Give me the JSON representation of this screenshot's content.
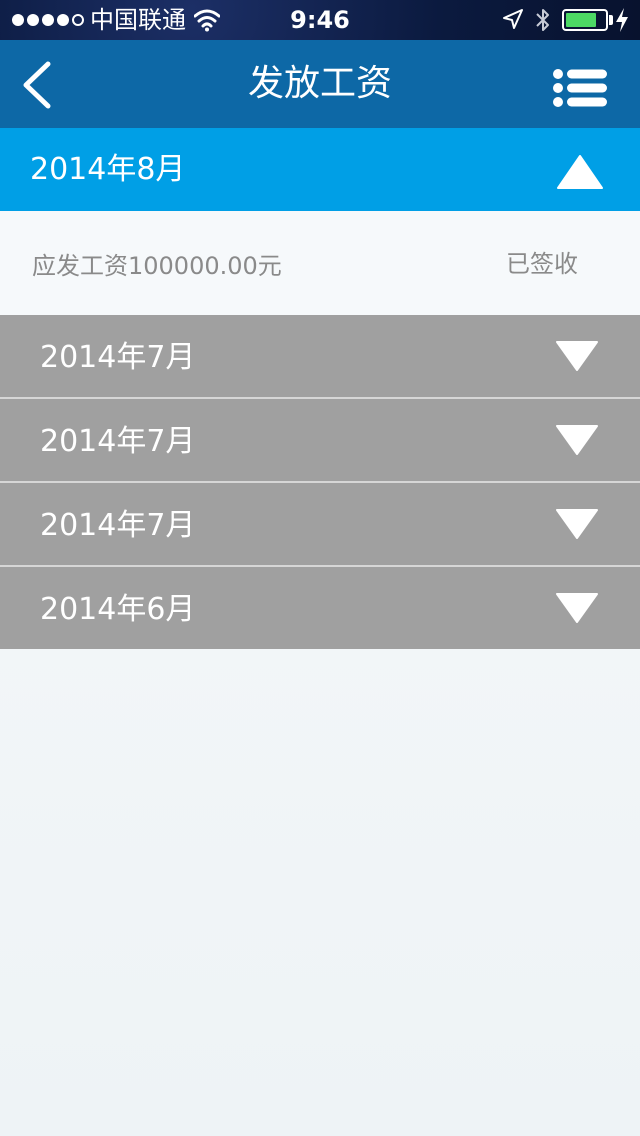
{
  "status_bar": {
    "carrier": "中国联通",
    "time": "9:46",
    "signal_dots": 5,
    "signal_filled": 4,
    "battery_level": 0.8,
    "icons": [
      "wifi-icon",
      "location-arrow-icon",
      "bluetooth-icon",
      "battery-icon",
      "charging-bolt-icon"
    ]
  },
  "nav": {
    "title": "发放工资",
    "back_icon": "chevron-left-icon",
    "menu_icon": "list-menu-icon"
  },
  "expanded_month": {
    "label": "2014年8月",
    "toggle_icon": "triangle-up-icon",
    "detail": {
      "amount_text": "应发工资100000.00元",
      "status_text": "已签收"
    }
  },
  "collapsed_months": [
    {
      "label": "2014年7月",
      "toggle_icon": "triangle-down-icon"
    },
    {
      "label": "2014年7月",
      "toggle_icon": "triangle-down-icon"
    },
    {
      "label": "2014年7月",
      "toggle_icon": "triangle-down-icon"
    },
    {
      "label": "2014年6月",
      "toggle_icon": "triangle-down-icon"
    }
  ],
  "colors": {
    "status_bar_bg": "#0b1a3f",
    "nav_bg": "#0d68a6",
    "expanded_header_bg": "#009fe6",
    "collapsed_row_bg": "#a0a0a0",
    "detail_text": "#8a8a8a",
    "battery_fill": "#4cd964"
  }
}
